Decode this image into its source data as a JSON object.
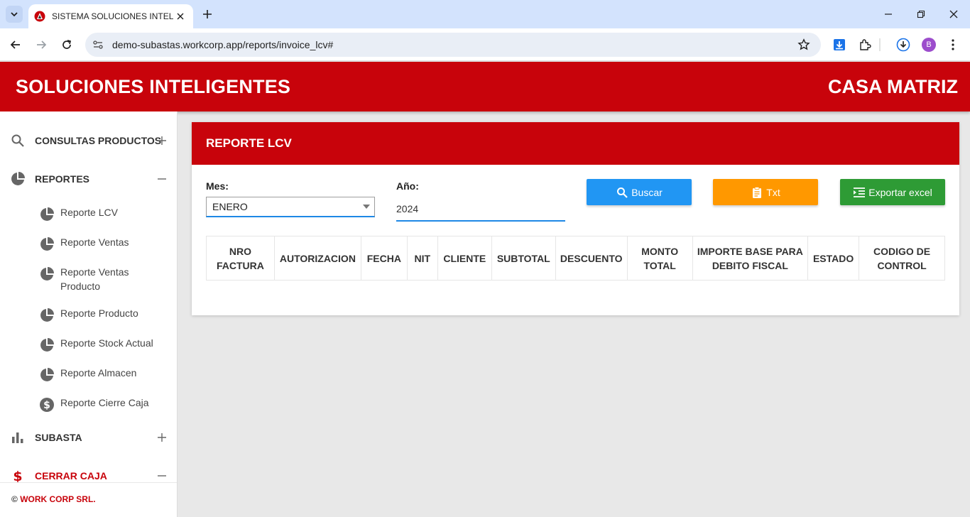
{
  "browser": {
    "tab_title": "SISTEMA SOLUCIONES INTELIGENTES",
    "url": "demo-subastas.workcorp.app/reports/invoice_lcv#",
    "profile_initial": "B"
  },
  "header": {
    "title": "SOLUCIONES INTELIGENTES",
    "branch": "CASA MATRIZ",
    "brand_color": "#c8030b"
  },
  "sidebar": {
    "groups": [
      {
        "label": "CONSULTAS PRODUCTOS",
        "icon": "search-icon",
        "toggle": "+"
      },
      {
        "label": "REPORTES",
        "icon": "pie-chart-icon",
        "toggle": "−"
      },
      {
        "label": "SUBASTA",
        "icon": "bar-chart-icon",
        "toggle": "+"
      },
      {
        "label": "CERRAR CAJA",
        "icon": "dollar-icon",
        "toggle": "−"
      }
    ],
    "report_items": [
      {
        "label": "Reporte LCV",
        "icon": "pie-chart-icon"
      },
      {
        "label": "Reporte Ventas",
        "icon": "pie-chart-icon"
      },
      {
        "label": "Reporte Ventas Producto",
        "icon": "pie-chart-icon"
      },
      {
        "label": "Reporte Producto",
        "icon": "pie-chart-icon"
      },
      {
        "label": "Reporte Stock Actual",
        "icon": "pie-chart-icon"
      },
      {
        "label": "Reporte Almacen",
        "icon": "pie-chart-icon"
      },
      {
        "label": "Reporte Cierre Caja",
        "icon": "dollar-circle-icon"
      }
    ],
    "footer": {
      "copyright": "©",
      "company": "WORK CORP SRL."
    }
  },
  "report": {
    "title": "REPORTE LCV",
    "month_label": "Mes:",
    "month_value": "ENERO",
    "year_label": "Año:",
    "year_value": "2024",
    "buttons": {
      "search": "Buscar",
      "txt": "Txt",
      "excel": "Exportar excel"
    },
    "button_colors": {
      "search": "#2196f3",
      "txt": "#ff9800",
      "excel": "#2e9b35"
    },
    "table_headers": [
      "NRO FACTURA",
      "AUTORIZACION",
      "FECHA",
      "NIT",
      "CLIENTE",
      "SUBTOTAL",
      "DESCUENTO",
      "MONTO TOTAL",
      "IMPORTE BASE PARA DEBITO FISCAL",
      "ESTADO",
      "CODIGO DE CONTROL"
    ]
  }
}
